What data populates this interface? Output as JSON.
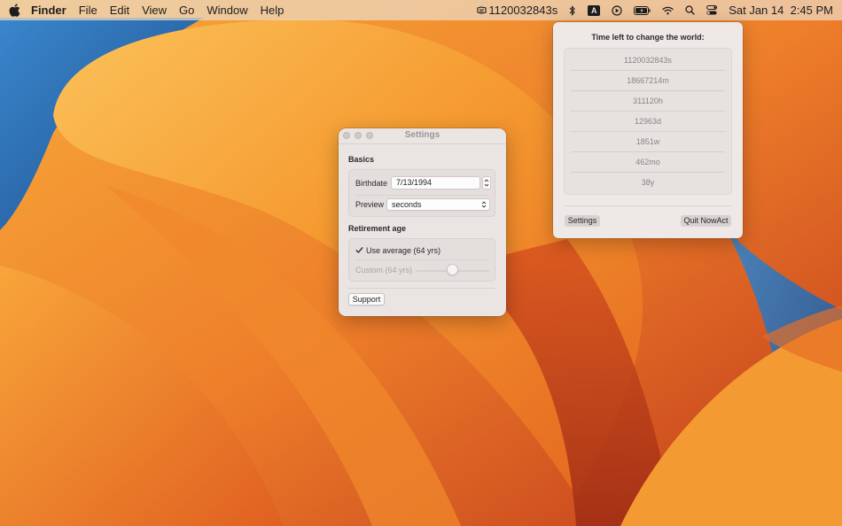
{
  "menubar": {
    "apple_icon": "apple-logo-icon",
    "app_name": "Finder",
    "menus": [
      "File",
      "Edit",
      "View",
      "Go",
      "Window",
      "Help"
    ],
    "status": {
      "nowact_icon": "nowact-icon",
      "nowact_value": "1120032843s",
      "icons": [
        "bluetooth-icon",
        "keyboard-input-icon",
        "play-circle-icon",
        "battery-icon",
        "wifi-icon",
        "search-icon",
        "control-center-icon"
      ],
      "input_source_letter": "A",
      "datetime": "Sat Jan 14  2:45 PM"
    }
  },
  "settings": {
    "title": "Settings",
    "basics_title": "Basics",
    "birthdate_label": "Birthdate",
    "birthdate_value": "7/13/1994",
    "preview_label": "Preview",
    "preview_value": "seconds",
    "retirement_title": "Retirement age",
    "use_average_label": "Use average (64 yrs)",
    "use_average_checked": true,
    "custom_label": "Custom (64 yrs)",
    "custom_slider_fraction": 0.5,
    "support_label": "Support"
  },
  "popover": {
    "title": "Time left to change the world:",
    "units": [
      "1120032843s",
      "18667214m",
      "311120h",
      "12963d",
      "1851w",
      "462mo",
      "38y"
    ],
    "settings_button": "Settings",
    "quit_button": "Quit NowAct"
  },
  "colors": {
    "wallpaper_orange": "#f39a2e",
    "wallpaper_dark_orange": "#d24a1f",
    "wallpaper_blue": "#2a6db5"
  }
}
